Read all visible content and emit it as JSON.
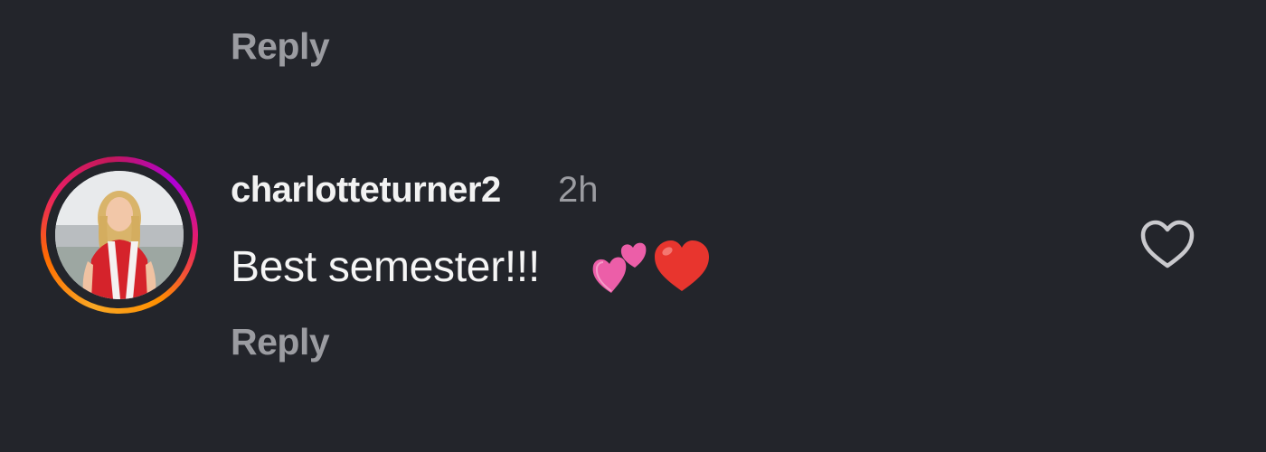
{
  "previous_comment": {
    "reply_label": "Reply"
  },
  "comment": {
    "username": "charlotteturner2",
    "time": "2h",
    "text": "Best semester!!!",
    "emojis": [
      "two-hearts",
      "red-heart"
    ],
    "reply_label": "Reply",
    "liked": false
  },
  "colors": {
    "background": "#23252b",
    "primary_text": "#f2f2f2",
    "secondary_text": "#9b9ca1",
    "story_ring": [
      "#f9a825",
      "#e91e63",
      "#b000d6"
    ]
  }
}
